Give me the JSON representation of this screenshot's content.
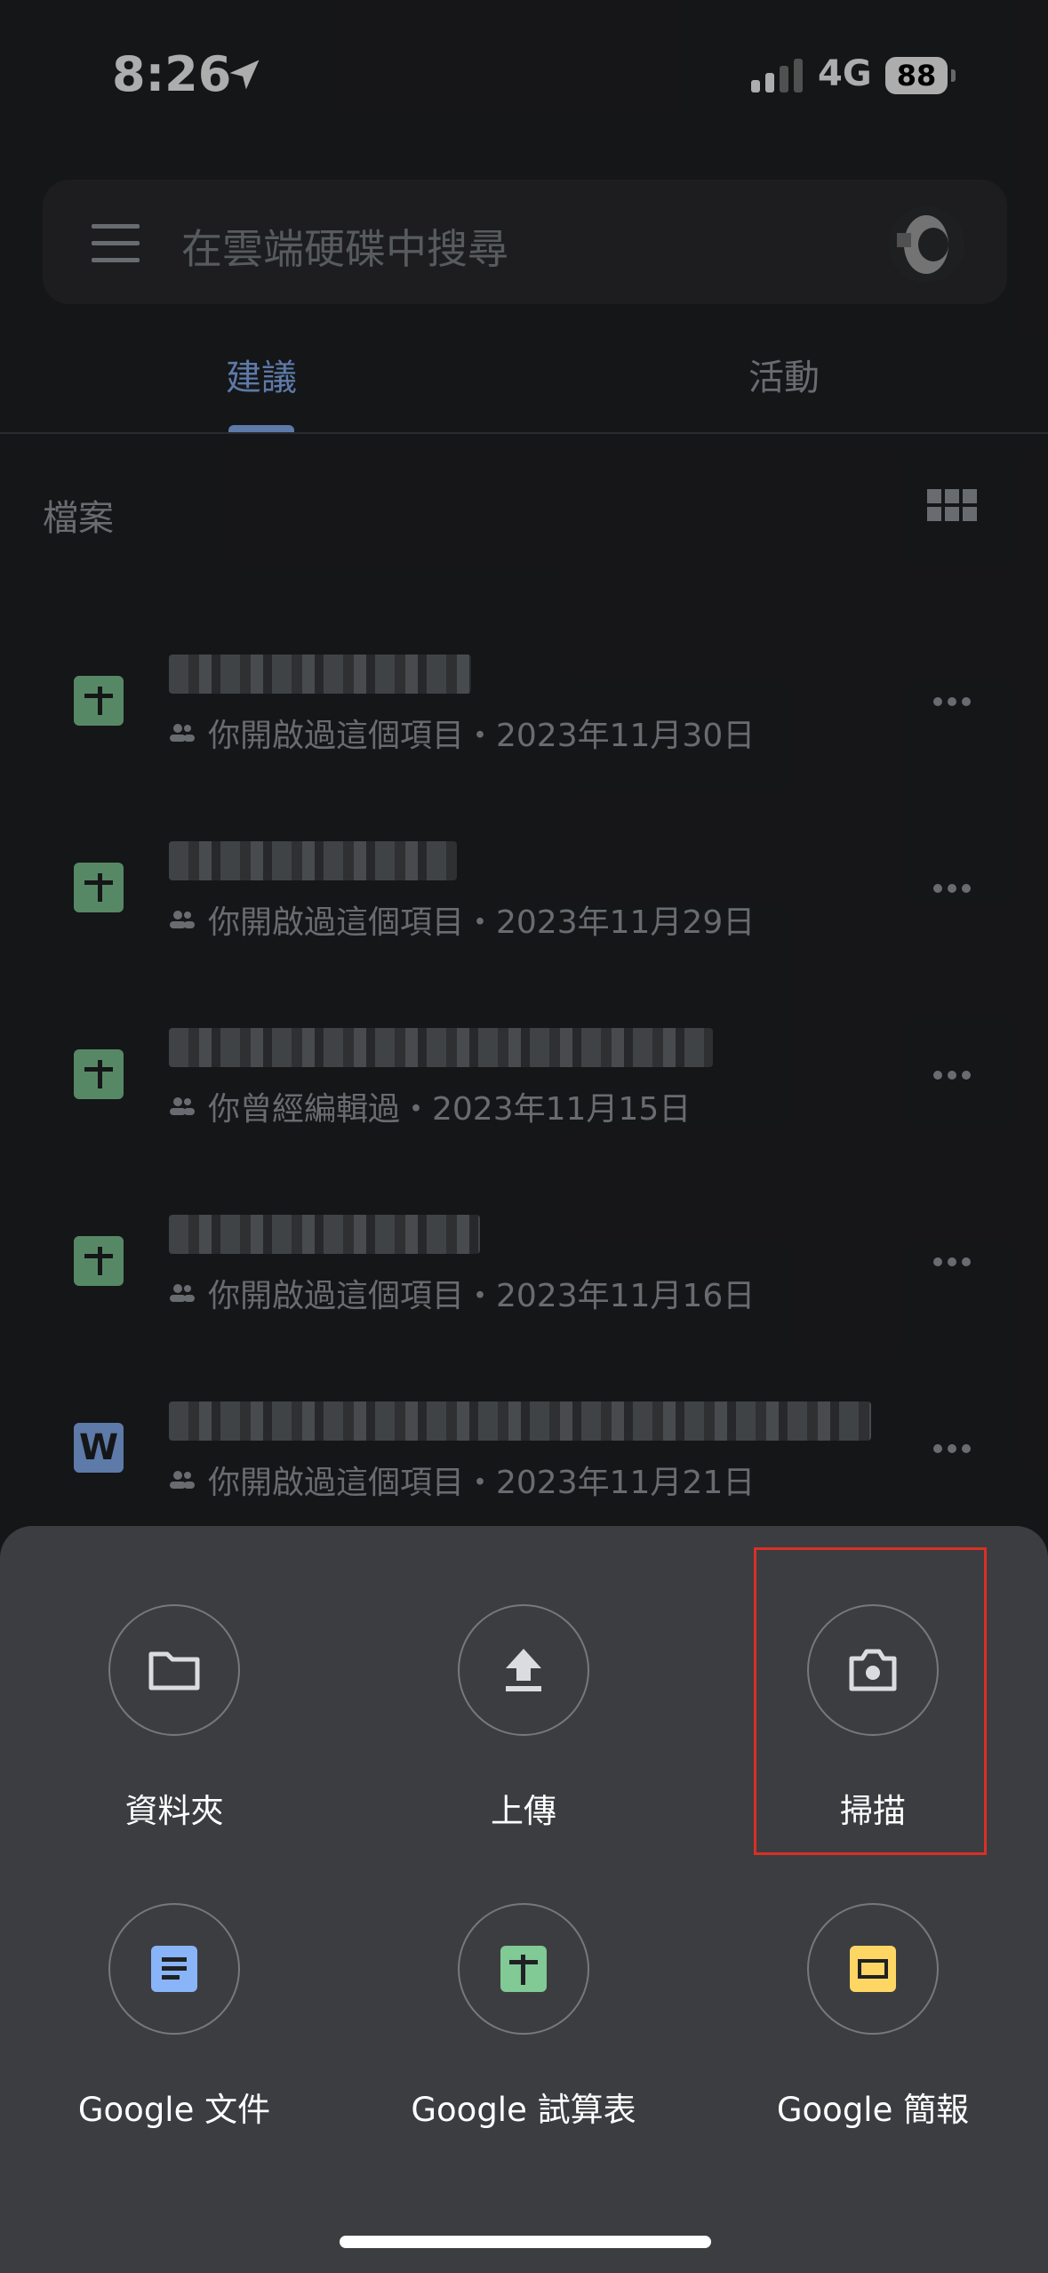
{
  "status_bar": {
    "time": "8:26",
    "network": "4G",
    "battery": "88"
  },
  "search": {
    "placeholder": "在雲端硬碟中搜尋"
  },
  "tabs": [
    {
      "label": "建議"
    },
    {
      "label": "活動"
    }
  ],
  "section": {
    "title": "檔案"
  },
  "files": [
    {
      "type": "sheet",
      "meta": "你開啟過這個項目・2023年11月30日"
    },
    {
      "type": "sheet",
      "meta": "你開啟過這個項目・2023年11月29日"
    },
    {
      "type": "sheet",
      "meta": "你曾經編輯過・2023年11月15日"
    },
    {
      "type": "sheet",
      "meta": "你開啟過這個項目・2023年11月16日"
    },
    {
      "type": "word",
      "icon_letter": "W",
      "meta": "你開啟過這個項目・2023年11月21日"
    }
  ],
  "create_menu": {
    "actions": [
      {
        "label": "資料夾",
        "icon": "folder-icon"
      },
      {
        "label": "上傳",
        "icon": "upload-icon"
      },
      {
        "label": "掃描",
        "icon": "camera-icon"
      },
      {
        "label": "Google 文件",
        "icon": "google-docs-icon"
      },
      {
        "label": "Google 試算表",
        "icon": "google-sheets-icon"
      },
      {
        "label": "Google 簡報",
        "icon": "google-slides-icon"
      }
    ]
  },
  "colors": {
    "accent": "#8ab4f8",
    "sheets": "#81c995",
    "slides": "#fdd663",
    "highlight": "#d93025"
  }
}
